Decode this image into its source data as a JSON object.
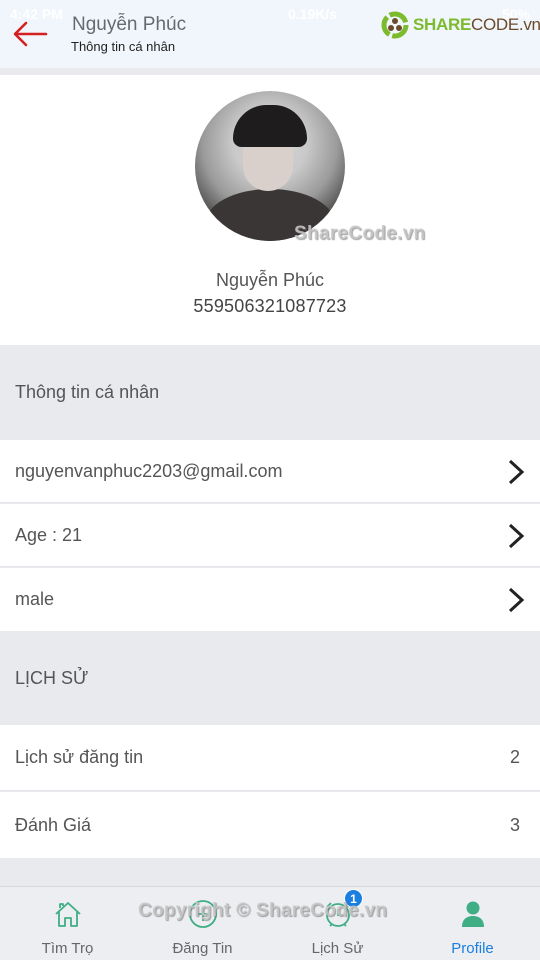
{
  "status_bar": {
    "time": "4:42 PM",
    "network_speed": "0.19K/s",
    "battery": "50%"
  },
  "header": {
    "title": "Nguyễn Phúc",
    "subtitle": "Thông tin cá nhân",
    "back_icon": "arrow-left-icon",
    "logo_prefix": "SHARE",
    "logo_suffix": "CODE.vn"
  },
  "profile": {
    "name": "Nguyễn Phúc",
    "id": "559506321087723"
  },
  "personal_info": {
    "heading": "Thông tin cá nhân",
    "items": [
      {
        "label": "nguyenvanphuc2203@gmail.com",
        "icon": "chevron-right-icon"
      },
      {
        "label": "Age : 21",
        "icon": "chevron-right-icon"
      },
      {
        "label": "male",
        "icon": "chevron-right-icon"
      }
    ]
  },
  "history": {
    "heading": "LỊCH SỬ",
    "items": [
      {
        "label": "Lịch sử đăng tin",
        "count": "2"
      },
      {
        "label": "Đánh Giá",
        "count": "3"
      }
    ]
  },
  "tabbar": {
    "tabs": [
      {
        "label": "Tìm Trọ",
        "icon": "home-icon"
      },
      {
        "label": "Đăng Tin",
        "icon": "post-icon"
      },
      {
        "label": "Lịch Sử",
        "icon": "alarm-clock-icon",
        "badge": "1"
      },
      {
        "label": "Profile",
        "icon": "user-icon",
        "active": true
      }
    ]
  },
  "watermarks": {
    "center": "ShareCode.vn",
    "bottom": "Copyright © ShareCode.vn"
  },
  "colors": {
    "accent": "#1a7fe0",
    "icon_green": "#3fae84",
    "back_arrow": "#d42020",
    "section_bg": "#e9eaee"
  }
}
